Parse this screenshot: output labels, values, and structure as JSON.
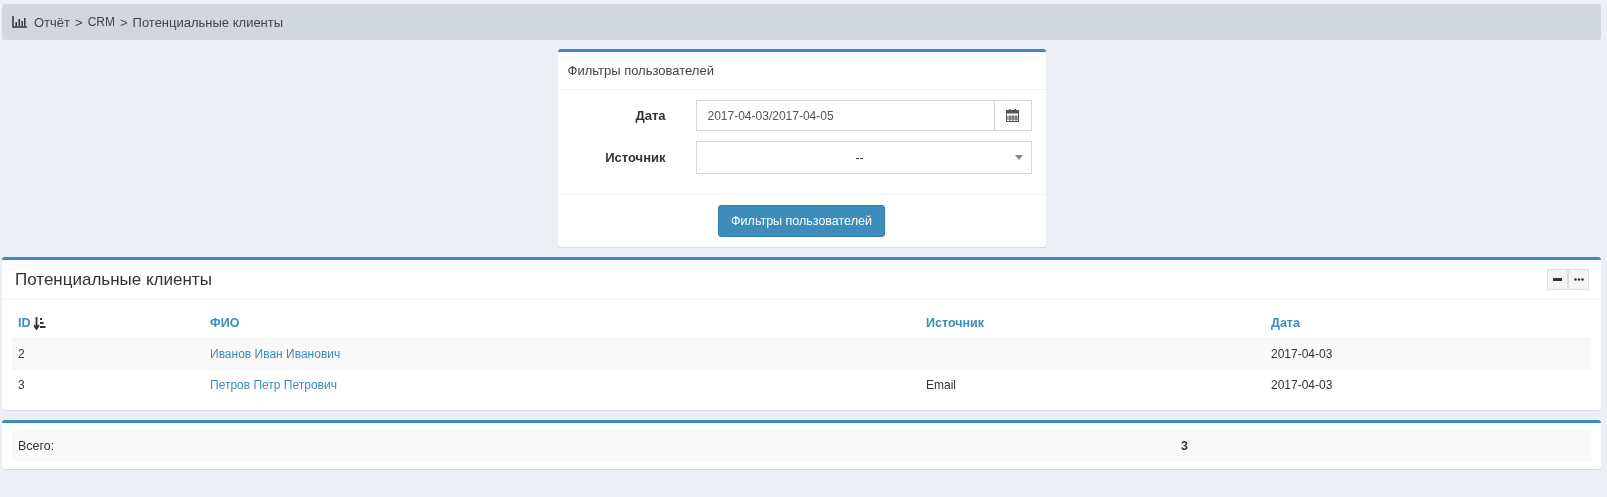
{
  "breadcrumb": {
    "separator": ">",
    "items": [
      "Отчёт",
      "CRM",
      "Потенциальные клиенты"
    ]
  },
  "filters": {
    "title": "Фильтры пользователей",
    "fields": [
      {
        "kind": "date",
        "label": "Дата",
        "value": "2017-04-03/2017-04-05"
      },
      {
        "kind": "select",
        "label": "Источник",
        "value": "--"
      }
    ],
    "submit": "Фильтры пользователей"
  },
  "table": {
    "title": "Потенциальные клиенты",
    "columns": [
      {
        "label": "ID",
        "sorted": true
      },
      {
        "label": "ФИО",
        "sorted": false
      },
      {
        "label": "Источник",
        "sorted": false
      },
      {
        "label": "Дата",
        "sorted": false
      }
    ],
    "rows": [
      [
        "2",
        "Иванов Иван Иванович",
        "",
        "2017-04-03"
      ],
      [
        "3",
        "Петров Петр Петрович",
        "Email",
        "2017-04-03"
      ]
    ]
  },
  "totals": {
    "label": "Всего:",
    "value": "3"
  }
}
